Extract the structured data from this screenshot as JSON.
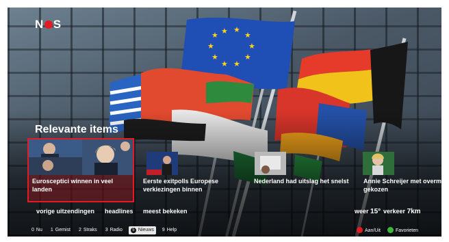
{
  "brand": {
    "logo_text_left": "N",
    "logo_text_right": "S",
    "accent": "#e41b23"
  },
  "section": {
    "title": "Relevante items"
  },
  "cards": [
    {
      "caption": "Eurosceptici winnen in veel landen",
      "selected": true
    },
    {
      "caption": "Eerste exitpolls Europese verkiezingen binnen",
      "selected": false
    },
    {
      "caption": "Nederland had uitslag het snelst",
      "selected": false
    },
    {
      "caption": "Annie Schreijer met overma gekozen",
      "selected": false
    }
  ],
  "nav": {
    "previous": "vorige uitzendingen",
    "headlines": "headlines",
    "most_viewed": "meest bekeken"
  },
  "info": {
    "weather_label": "weer",
    "weather_value": "15°",
    "traffic_label": "verkeer",
    "traffic_value": "7km"
  },
  "bottombar": {
    "items": [
      {
        "num": "0",
        "label": "Nu"
      },
      {
        "num": "1",
        "label": "Gemist"
      },
      {
        "num": "2",
        "label": "Straks"
      },
      {
        "num": "3",
        "label": "Radio"
      },
      {
        "num": "5",
        "label": "Nieuws"
      },
      {
        "num": "9",
        "label": "Help"
      }
    ]
  },
  "colorkeys": {
    "red_label": "Aan/Uit",
    "green_label": "Favorieten",
    "red_color": "#e41b23",
    "green_color": "#3cb83c"
  }
}
